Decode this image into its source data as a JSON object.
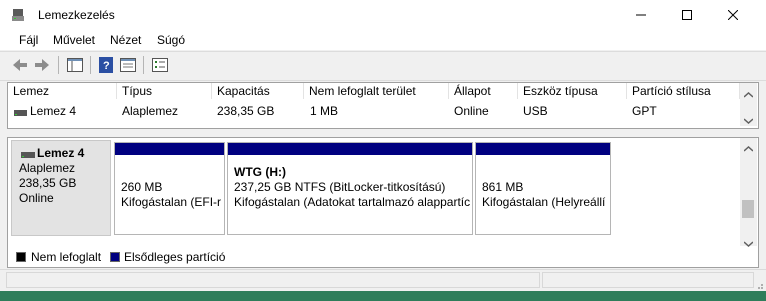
{
  "window": {
    "title": "Lemezkezelés"
  },
  "menu": [
    "Fájl",
    "Művelet",
    "Nézet",
    "Súgó"
  ],
  "list": {
    "columns": [
      "Lemez",
      "Típus",
      "Kapacitás",
      "Nem lefoglalt terület",
      "Állapot",
      "Eszköz típusa",
      "Partíció stílusa"
    ],
    "rows": [
      [
        "Lemez 4",
        "Alaplemez",
        "238,35 GB",
        "1 MB",
        "Online",
        "USB",
        "GPT"
      ]
    ]
  },
  "disk": {
    "name": "Lemez 4",
    "type": "Alaplemez",
    "size": "238,35 GB",
    "status": "Online"
  },
  "partitions": [
    {
      "size": "260 MB",
      "status": "Kifogástalan (EFI-r"
    },
    {
      "name": "WTG  (H:)",
      "size": "237,25 GB NTFS (BitLocker-titkosítású)",
      "status": "Kifogástalan (Adatokat tartalmazó alappartíc"
    },
    {
      "size": "861 MB",
      "status": "Kifogástalan (Helyreállí"
    }
  ],
  "legend": {
    "unallocated": "Nem lefoglalt",
    "primary": "Elsődleges partíció",
    "colors": {
      "unallocated": "#000000",
      "primary": "#000080"
    }
  }
}
